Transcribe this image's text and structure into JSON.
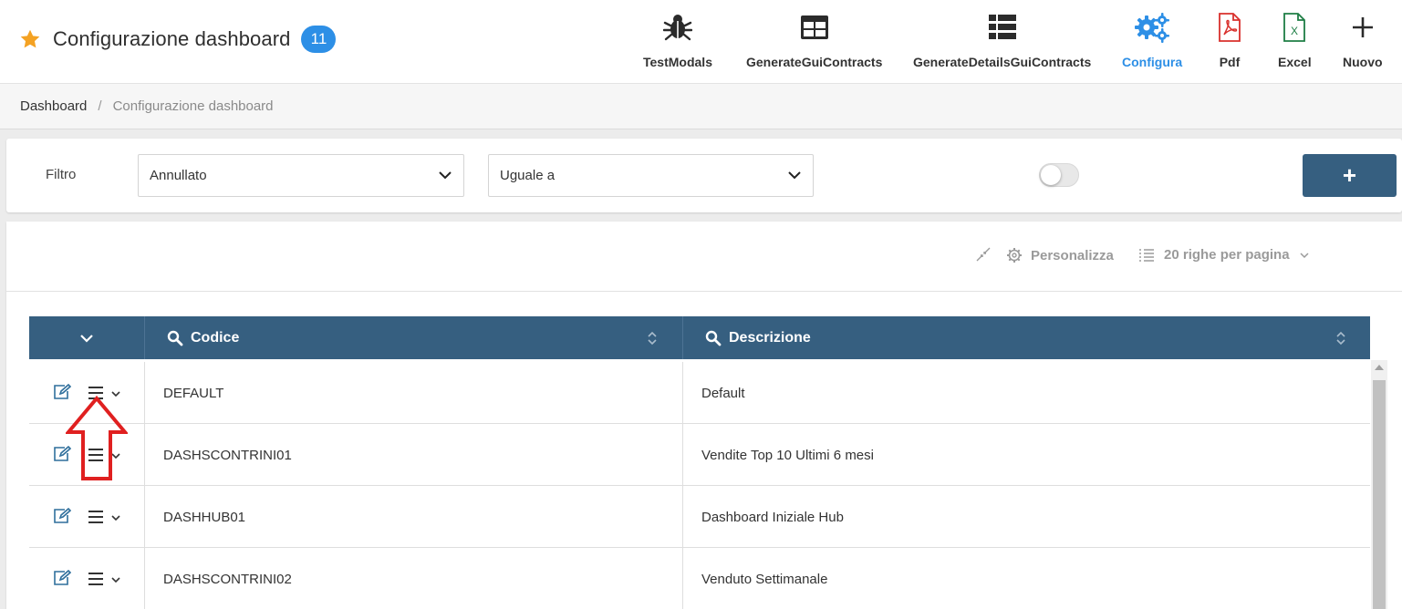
{
  "header": {
    "title": "Configurazione dashboard",
    "count_badge": "11",
    "star_icon": "star-icon",
    "toolbar": [
      {
        "label": "TestModals",
        "icon": "bug-icon"
      },
      {
        "label": "GenerateGuiContracts",
        "icon": "table-grid-icon"
      },
      {
        "label": "GenerateDetailsGuiContracts",
        "icon": "list-table-icon"
      },
      {
        "label": "Configura",
        "icon": "gears-icon",
        "active": true
      },
      {
        "label": "Pdf",
        "icon": "pdf-file-icon"
      },
      {
        "label": "Excel",
        "icon": "excel-file-icon"
      },
      {
        "label": "Nuovo",
        "icon": "plus-icon"
      }
    ]
  },
  "breadcrumb": {
    "home": "Dashboard",
    "separator": "/",
    "current": "Configurazione dashboard"
  },
  "filter": {
    "label": "Filtro",
    "field_value": "Annullato",
    "operator_value": "Uguale a",
    "add_label": "+"
  },
  "grid_toolbar": {
    "personalize_label": "Personalizza",
    "page_size_label": "20 righe per pagina"
  },
  "table": {
    "columns": [
      "Codice",
      "Descrizione"
    ],
    "rows": [
      {
        "codice": "DEFAULT",
        "descrizione": "Default"
      },
      {
        "codice": "DASHSCONTRINI01",
        "descrizione": "Vendite Top 10 Ultimi 6 mesi"
      },
      {
        "codice": "DASHHUB01",
        "descrizione": "Dashboard Iniziale Hub"
      },
      {
        "codice": "DASHSCONTRINI02",
        "descrizione": "Venduto Settimanale"
      }
    ]
  },
  "colors": {
    "accent": "#2d8fe6",
    "header_table": "#365f80",
    "pdf": "#d9302c",
    "excel": "#1e7e45",
    "annotation": "#e02020",
    "star": "#f4a223"
  }
}
